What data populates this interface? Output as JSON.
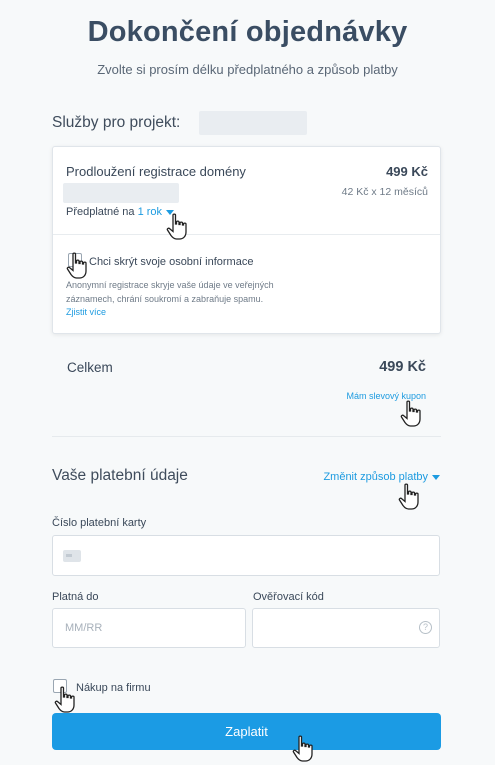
{
  "page": {
    "title": "Dokončení objednávky",
    "subtitle": "Zvolte si prosím délku předplatného a způsob platby"
  },
  "services": {
    "label": "Služby pro projekt:",
    "item": {
      "name": "Prodloužení registrace domény",
      "price": "499 Kč",
      "price_detail": "42 Kč x 12 měsíců",
      "subscription_prefix": "Předplatné na",
      "subscription_value": "1 rok"
    },
    "privacy": {
      "label": "Chci skrýt svoje osobní informace",
      "description": "Anonymní registrace skryje vaše údaje ve veřejných záznamech, chrání soukromí a zabraňuje spamu.",
      "more_link": "Zjistit více"
    }
  },
  "total": {
    "label": "Celkem",
    "price": "499 Kč",
    "coupon_link": "Mám slevový kupon"
  },
  "payment": {
    "label": "Vaše platební údaje",
    "change_method": "Změnit způsob platby",
    "card_number_label": "Číslo platební karty",
    "valid_until_label": "Platná do",
    "valid_until_placeholder": "MM/RR",
    "cvc_label": "Ověřovací kód",
    "company_label": "Nákup na firmu",
    "submit_label": "Zaplatit"
  },
  "icons": {
    "cursor": "hand-pointer-icon",
    "help": "question-circle-icon",
    "card": "credit-card-icon",
    "caret": "caret-down-icon"
  },
  "colors": {
    "accent": "#1b9be4",
    "link": "#1d9be0",
    "title": "#3a4d63"
  }
}
